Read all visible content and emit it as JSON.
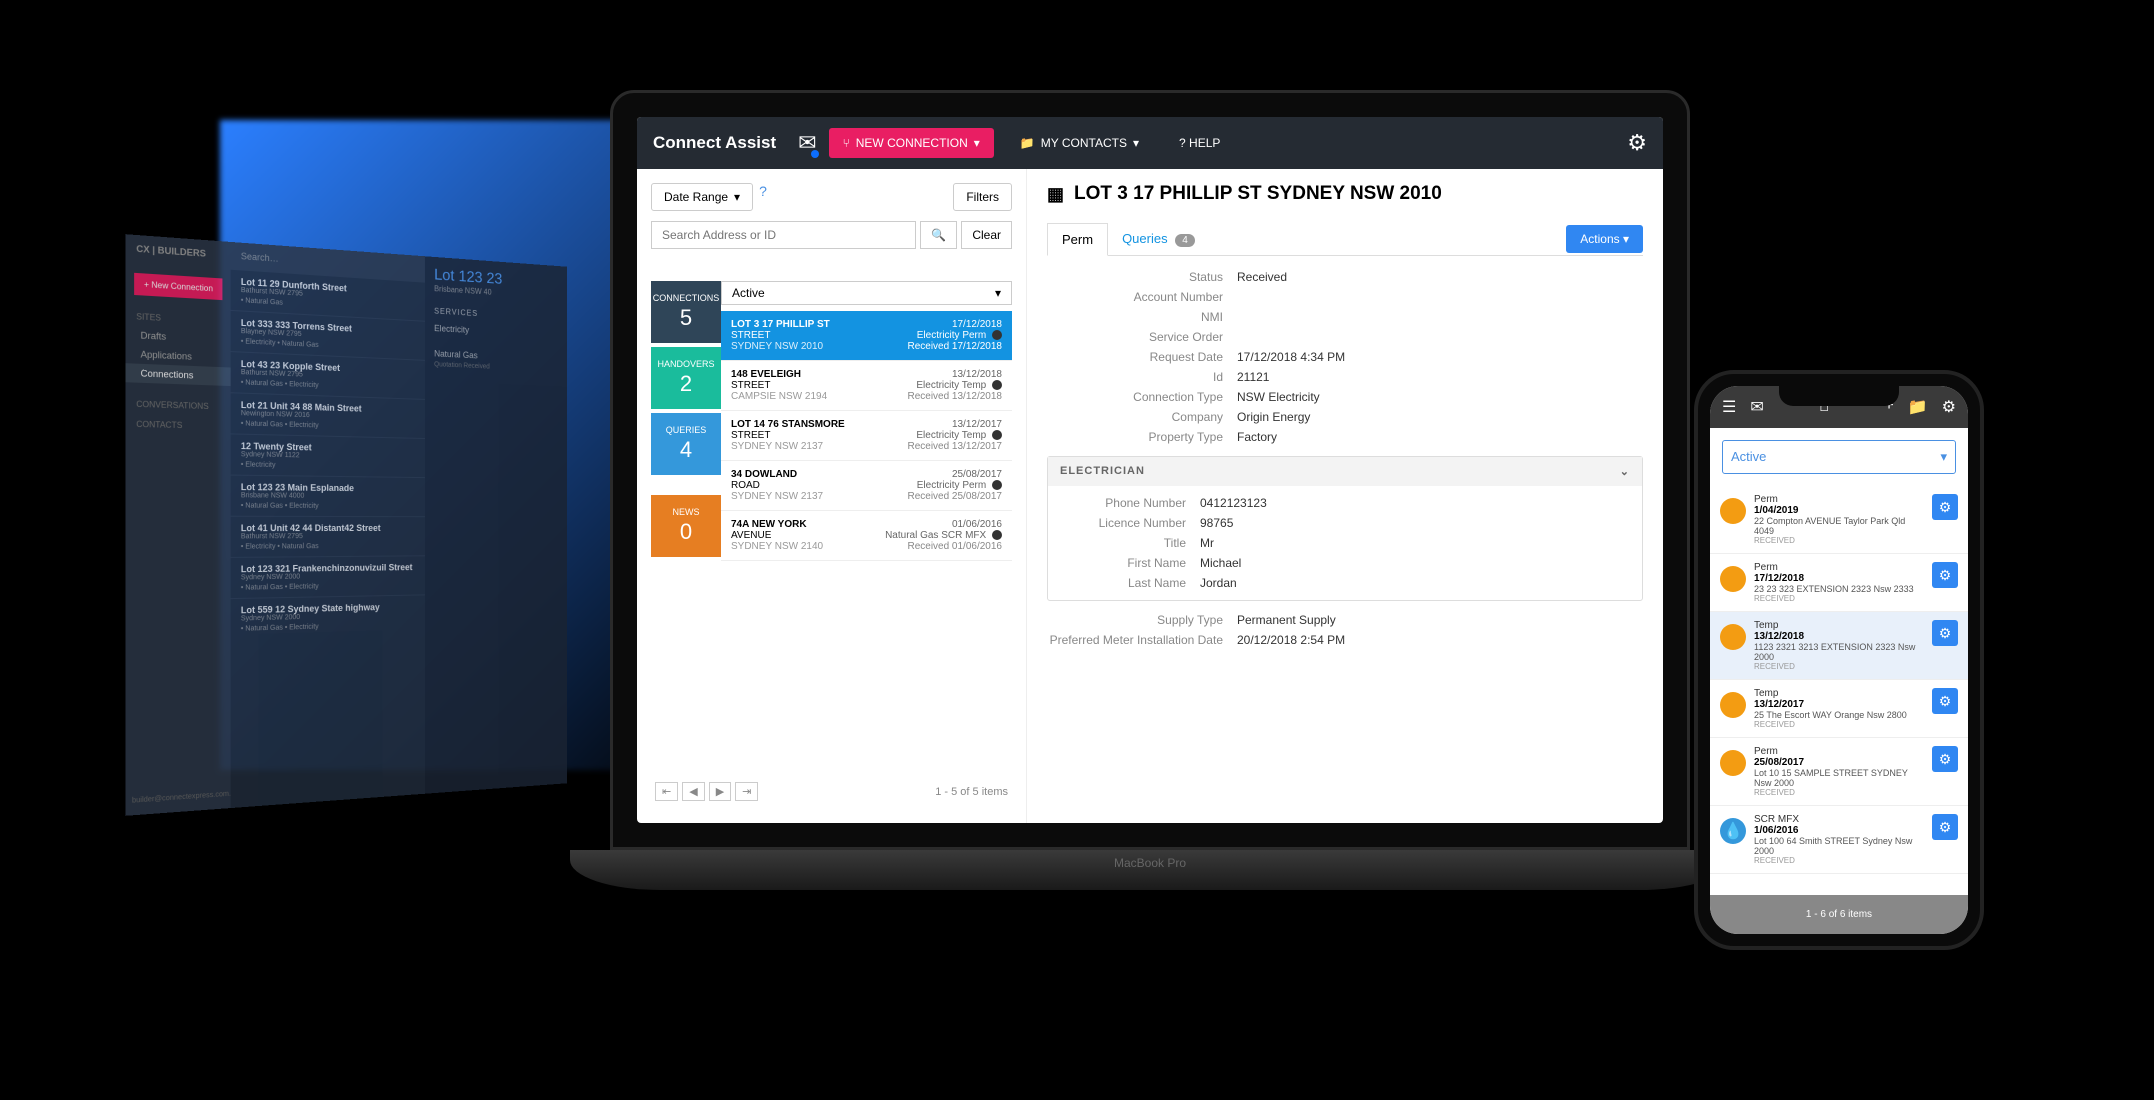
{
  "back_laptop": {
    "brand": "CX | BUILDERS",
    "new_conn": "+ New Connection",
    "search_placeholder": "Search…",
    "nav": {
      "sites": "SITES",
      "drafts": "Drafts",
      "applications": "Applications",
      "connections": "Connections",
      "conversations": "CONVERSATIONS",
      "contacts": "CONTACTS"
    },
    "footer": "builder@connectexpress.com.au",
    "items": [
      {
        "name": "Lot 11 29 Dunforth Street",
        "addr": "Bathurst NSW 2795",
        "tags": "• Natural Gas"
      },
      {
        "name": "Lot 333 333 Torrens Street",
        "addr": "Blayney NSW 2795",
        "tags": "• Electricity  • Natural Gas"
      },
      {
        "name": "Lot 43 23 Kopple Street",
        "addr": "Bathurst NSW 2795",
        "tags": "• Natural Gas  • Electricity"
      },
      {
        "name": "Lot 21 Unit 34 88 Main Street",
        "addr": "Newington NSW 2016",
        "tags": "• Natural Gas  • Electricity"
      },
      {
        "name": "12 Twenty Street",
        "addr": "Sydney NSW 1122",
        "tags": "• Electricity"
      },
      {
        "name": "Lot 123 23 Main Esplanade",
        "addr": "Brisbane NSW 4000",
        "tags": "• Natural Gas  • Electricity"
      },
      {
        "name": "Lot 41 Unit 42 44 Distant42 Street",
        "addr": "Bathurst NSW 2795",
        "tags": "• Electricity  • Natural Gas"
      },
      {
        "name": "Lot 123 321 Frankenchinzonuvizuil Street",
        "addr": "Sydney NSW 2000",
        "tags": "• Natural Gas  • Electricity"
      },
      {
        "name": "Lot 559 12 Sydney State highway",
        "addr": "Sydney NSW 2000",
        "tags": "• Natural Gas  • Electricity"
      }
    ],
    "detail": {
      "title": "Lot 123 23",
      "sub": "Brisbane NSW 40",
      "services_label": "SERVICES",
      "svc1": "Electricity",
      "svc2": "Natural Gas",
      "svc2_sub": "Quotation Received"
    }
  },
  "topbar": {
    "logo": "Connect Assist",
    "new_conn": "NEW CONNECTION",
    "my_contacts": "MY CONTACTS",
    "help": "?  HELP"
  },
  "left": {
    "date_range": "Date Range",
    "filters": "Filters",
    "search_placeholder": "Search Address or ID",
    "clear": "Clear",
    "active": "Active",
    "cats": [
      {
        "label": "CONNECTIONS",
        "num": "5"
      },
      {
        "label": "HANDOVERS",
        "num": "2"
      },
      {
        "label": "QUERIES",
        "num": "4"
      },
      {
        "label": "NEWS",
        "num": "0"
      }
    ],
    "items": [
      {
        "t": "LOT 3 17 PHILLIP ST",
        "s": "STREET",
        "c": "SYDNEY NSW 2010",
        "d": "17/12/2018",
        "ty": "Electricity Perm",
        "rc": "Received 17/12/2018"
      },
      {
        "t": "148 EVELEIGH",
        "s": "STREET",
        "c": "CAMPSIE NSW 2194",
        "d": "13/12/2018",
        "ty": "Electricity Temp",
        "rc": "Received 13/12/2018"
      },
      {
        "t": "LOT 14 76 STANSMORE",
        "s": "STREET",
        "c": "SYDNEY NSW 2137",
        "d": "13/12/2017",
        "ty": "Electricity Temp",
        "rc": "Received 13/12/2017"
      },
      {
        "t": "34 DOWLAND",
        "s": "ROAD",
        "c": "SYDNEY NSW 2137",
        "d": "25/08/2017",
        "ty": "Electricity Perm",
        "rc": "Received 25/08/2017"
      },
      {
        "t": "74A NEW YORK",
        "s": "AVENUE",
        "c": "SYDNEY NSW 2140",
        "d": "01/06/2016",
        "ty": "Natural Gas SCR MFX",
        "rc": "Received 01/06/2016"
      }
    ],
    "pager_text": "1 - 5 of 5 items"
  },
  "right": {
    "title": "LOT 3 17 PHILLIP ST SYDNEY NSW 2010",
    "tab_perm": "Perm",
    "tab_queries": "Queries",
    "queries_count": "4",
    "actions": "Actions",
    "details": [
      {
        "lbl": "Status",
        "val": "Received"
      },
      {
        "lbl": "Account Number",
        "val": ""
      },
      {
        "lbl": "NMI",
        "val": ""
      },
      {
        "lbl": "Service Order",
        "val": ""
      },
      {
        "lbl": "Request Date",
        "val": "17/12/2018 4:34 PM"
      },
      {
        "lbl": "Id",
        "val": "21121"
      },
      {
        "lbl": "Connection Type",
        "val": "NSW Electricity"
      },
      {
        "lbl": "Company",
        "val": "Origin Energy"
      },
      {
        "lbl": "Property Type",
        "val": "Factory"
      }
    ],
    "elec_header": "ELECTRICIAN",
    "elec": [
      {
        "lbl": "Phone Number",
        "val": "0412123123"
      },
      {
        "lbl": "Licence Number",
        "val": "98765"
      },
      {
        "lbl": "Title",
        "val": "Mr"
      },
      {
        "lbl": "First Name",
        "val": "Michael"
      },
      {
        "lbl": "Last Name",
        "val": "Jordan"
      }
    ],
    "supply": [
      {
        "lbl": "Supply Type",
        "val": "Permanent Supply"
      },
      {
        "lbl": "Preferred Meter Installation Date",
        "val": "20/12/2018 2:54 PM"
      }
    ]
  },
  "mb_brand": "MacBook Pro",
  "phone": {
    "active": "Active",
    "items": [
      {
        "ty": "Perm",
        "dt": "1/04/2019",
        "ad": "22 Compton AVENUE Taylor Park Qld 4049",
        "st": "RECEIVED",
        "color": "org"
      },
      {
        "ty": "Perm",
        "dt": "17/12/2018",
        "ad": "23 23 323 EXTENSION 2323 Nsw 2333",
        "st": "RECEIVED",
        "color": "org"
      },
      {
        "ty": "Temp",
        "dt": "13/12/2018",
        "ad": "1123 2321 3213 EXTENSION 2323 Nsw 2000",
        "st": "RECEIVED",
        "color": "org",
        "sel": true
      },
      {
        "ty": "Temp",
        "dt": "13/12/2017",
        "ad": "25 The Escort WAY Orange Nsw 2800",
        "st": "RECEIVED",
        "color": "org"
      },
      {
        "ty": "Perm",
        "dt": "25/08/2017",
        "ad": "Lot 10 15 SAMPLE STREET SYDNEY Nsw 2000",
        "st": "RECEIVED",
        "color": "org"
      },
      {
        "ty": "SCR MFX",
        "dt": "1/06/2016",
        "ad": "Lot 100 64 Smith STREET Sydney Nsw 2000",
        "st": "RECEIVED",
        "color": "blu"
      }
    ],
    "pager": "1 - 6 of 6 items"
  }
}
